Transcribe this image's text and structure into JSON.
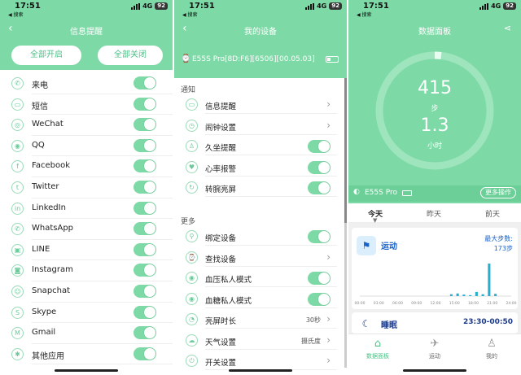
{
  "status": {
    "time": "17:51",
    "back": "◀ 搜索",
    "network": "4G",
    "battery": "92"
  },
  "screen1": {
    "title": "信息提醒",
    "btn_all_on": "全部开启",
    "btn_all_off": "全部关闭",
    "items": [
      {
        "label": "来电",
        "icon": "phone-icon",
        "glyph": "✆",
        "on": true
      },
      {
        "label": "短信",
        "icon": "sms-icon",
        "glyph": "▭",
        "on": true
      },
      {
        "label": "WeChat",
        "icon": "wechat-icon",
        "glyph": "◎",
        "on": true
      },
      {
        "label": "QQ",
        "icon": "qq-icon",
        "glyph": "◉",
        "on": true
      },
      {
        "label": "Facebook",
        "icon": "facebook-icon",
        "glyph": "f",
        "on": true
      },
      {
        "label": "Twitter",
        "icon": "twitter-icon",
        "glyph": "t",
        "on": true
      },
      {
        "label": "LinkedIn",
        "icon": "linkedin-icon",
        "glyph": "in",
        "on": true
      },
      {
        "label": "WhatsApp",
        "icon": "whatsapp-icon",
        "glyph": "✆",
        "on": true
      },
      {
        "label": "LINE",
        "icon": "line-icon",
        "glyph": "▣",
        "on": true
      },
      {
        "label": "Instagram",
        "icon": "instagram-icon",
        "glyph": "◙",
        "on": true
      },
      {
        "label": "Snapchat",
        "icon": "snapchat-icon",
        "glyph": "☺",
        "on": true
      },
      {
        "label": "Skype",
        "icon": "skype-icon",
        "glyph": "S",
        "on": true
      },
      {
        "label": "Gmail",
        "icon": "gmail-icon",
        "glyph": "M",
        "on": true
      },
      {
        "label": "其他应用",
        "icon": "other-apps-icon",
        "glyph": "✱",
        "on": true
      }
    ]
  },
  "screen2": {
    "title": "我的设备",
    "device": "E55S Pro[8D:F6][6506][00.05.03]",
    "section_notify": "通知",
    "section_more": "更多",
    "notify_items": [
      {
        "label": "信息提醒",
        "icon": "message-icon",
        "glyph": "▭",
        "type": "chevron"
      },
      {
        "label": "闹钟设置",
        "icon": "alarm-icon",
        "glyph": "◷",
        "type": "chevron"
      },
      {
        "label": "久坐提醒",
        "icon": "sedentary-icon",
        "glyph": "♙",
        "type": "toggle"
      },
      {
        "label": "心率报警",
        "icon": "heart-icon",
        "glyph": "♥",
        "type": "toggle"
      },
      {
        "label": "转腕亮屏",
        "icon": "wrist-icon",
        "glyph": "↻",
        "type": "toggle"
      }
    ],
    "more_items": [
      {
        "label": "绑定设备",
        "icon": "bind-icon",
        "glyph": "⚲",
        "type": "toggle",
        "value": ""
      },
      {
        "label": "查找设备",
        "icon": "find-icon",
        "glyph": "⌚",
        "type": "chevron",
        "value": ""
      },
      {
        "label": "血压私人模式",
        "icon": "blood-pressure-icon",
        "glyph": "◉",
        "type": "toggle",
        "value": ""
      },
      {
        "label": "血糖私人模式",
        "icon": "blood-sugar-icon",
        "glyph": "◉",
        "type": "toggle",
        "value": ""
      },
      {
        "label": "亮屏时长",
        "icon": "screen-time-icon",
        "glyph": "◔",
        "type": "chevron",
        "value": "30秒"
      },
      {
        "label": "天气设置",
        "icon": "weather-icon",
        "glyph": "☁",
        "type": "chevron",
        "value": "摄氏度"
      },
      {
        "label": "开关设置",
        "icon": "switch-icon",
        "glyph": "⏻",
        "type": "chevron",
        "value": ""
      }
    ]
  },
  "screen3": {
    "title": "数据面板",
    "steps": "415",
    "steps_unit": "步",
    "hours": "1.3",
    "hours_unit": "小时",
    "device": "E55S Pro",
    "more_ops": "更多操作",
    "tabs": [
      "今天",
      "昨天",
      "前天"
    ],
    "activity": {
      "title": "运动",
      "max_label": "最大步数:",
      "max_value": "173步",
      "x_labels": [
        "00:00",
        "03:00",
        "06:00",
        "09:00",
        "12:00",
        "15:00",
        "18:00",
        "21:00",
        "24:00"
      ],
      "hourly_steps": [
        0,
        0,
        0,
        0,
        0,
        0,
        0,
        0,
        0,
        0,
        0,
        0,
        0,
        0,
        10,
        14,
        8,
        5,
        22,
        10,
        173,
        12,
        0,
        0
      ]
    },
    "sleep": {
      "title": "睡眠",
      "range": "23:30-00:50"
    },
    "nav": [
      {
        "label": "数据面板",
        "icon": "dashboard-icon",
        "glyph": "⌂",
        "active": true
      },
      {
        "label": "运动",
        "icon": "run-icon",
        "glyph": "✈",
        "active": false
      },
      {
        "label": "我的",
        "icon": "profile-icon",
        "glyph": "♙",
        "active": false
      }
    ],
    "accent": "#7dd9a6",
    "chart_color": "#2aaed0"
  }
}
